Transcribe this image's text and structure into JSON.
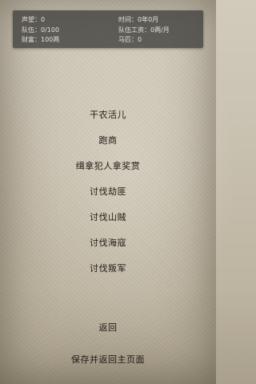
{
  "status": {
    "reputation": "声望：0",
    "time": "时间：0年0月",
    "troops": "队伍：0/100",
    "wage": "队伍工资：0两/月",
    "wealth": "财富：100两",
    "horses": "马匹：0"
  },
  "menu": {
    "farm": "干农活儿",
    "trade": "跑商",
    "bounty": "缉拿犯人拿奖赏",
    "bandits": "讨伐劫匪",
    "mountain": "讨伐山贼",
    "pirates": "讨伐海寇",
    "rebels": "讨伐叛军",
    "back": "返回",
    "save_home": "保存并返回主页面"
  }
}
